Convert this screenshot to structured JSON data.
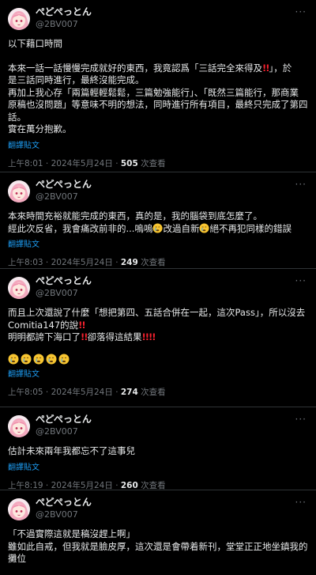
{
  "user": {
    "display_name": "ぺどぺっとん",
    "handle": "@2BV007"
  },
  "icons": {
    "more": "more-options-icon",
    "avatar": "avatar-anime-girl"
  },
  "colors": {
    "background": "#000000",
    "text": "#e7e9ea",
    "muted": "#71767b",
    "link": "#1d9bf0",
    "exclaim": "#f4212e"
  },
  "translate_label": "翻譯貼文",
  "views_label": "次查看",
  "tweets": [
    {
      "l1": "以下藉口時間",
      "l2a": "本來一話一話慢慢完成就好的東西，我竟認爲「三話完全來得及",
      "l2b": "」，於",
      "l3": "是三話同時進行，最終沒能完成。",
      "l4": "再加上我心存「兩篇輕輕鬆鬆，三篇勉強能行」、「既然三篇能行，那商業",
      "l5": "原稿也沒問題」等意味不明的想法，同時進行所有項目，最終只完成了第四",
      "l6": "話。",
      "l7": "實在萬分抱歉。",
      "time": "上午8:01 · 2024年5月24日 · ",
      "views": "505"
    },
    {
      "l1": "本來時間充裕就能完成的東西，真的是，我的腦袋到底怎麼了。",
      "l2a": "經此次反省，我會痛改前非的...嗚嗚",
      "l2b": "改過自新",
      "l2c": "絕不再犯同樣的錯誤",
      "time": "上午8:03 · 2024年5月24日 · ",
      "views": "249"
    },
    {
      "l1": "而且上次還說了什麼「想把第四、五話合併在一起，這次Pass」，所以沒去",
      "l2": "Comitia147的說",
      "l3a": "明明都誇下海口了",
      "l3b": "卻落得這結果",
      "time": "上午8:05 · 2024年5月24日 · ",
      "views": "274"
    },
    {
      "l1": "估計未來兩年我都忘不了這事兒",
      "time": "上午8:19 · 2024年5月24日 · ",
      "views": "260"
    },
    {
      "l1": "「不過實際這就是稿沒趕上啊」",
      "l2": "雖如此自戒，但我就是臉皮厚，這次還是會帶着新刊，堂堂正正地坐鎮我的",
      "l3": "攤位"
    }
  ]
}
